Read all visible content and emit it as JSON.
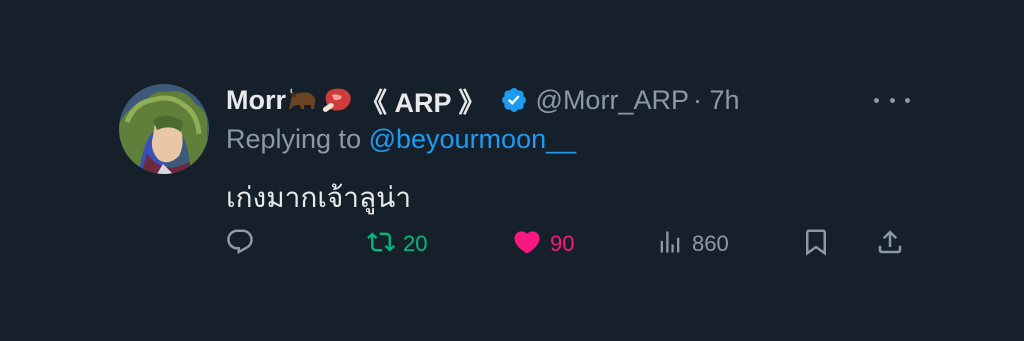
{
  "tweet": {
    "display_name": "Morr",
    "name_suffix": "《 ARP 》",
    "name_emojis": [
      "bison-emoji",
      "meat-emoji"
    ],
    "handle": "@Morr_ARP",
    "time": "· 7h",
    "replying_prefix": "Replying to ",
    "replying_to": "@beyourmoon__",
    "text": "เก่งมากเจ้าลูน่า",
    "stats": {
      "retweets": "20",
      "likes": "90",
      "views": "860"
    }
  },
  "colors": {
    "background": "#15202b",
    "text": "#e7e9ea",
    "muted": "#8b98a5",
    "link": "#1d9bf0",
    "retweet": "#00ba7c",
    "like": "#f91880",
    "verified": "#1d9bf0"
  },
  "icons": [
    "reply-icon",
    "retweet-icon",
    "heart-icon",
    "views-icon",
    "bookmark-icon",
    "share-icon",
    "verified-icon",
    "more-icon"
  ]
}
